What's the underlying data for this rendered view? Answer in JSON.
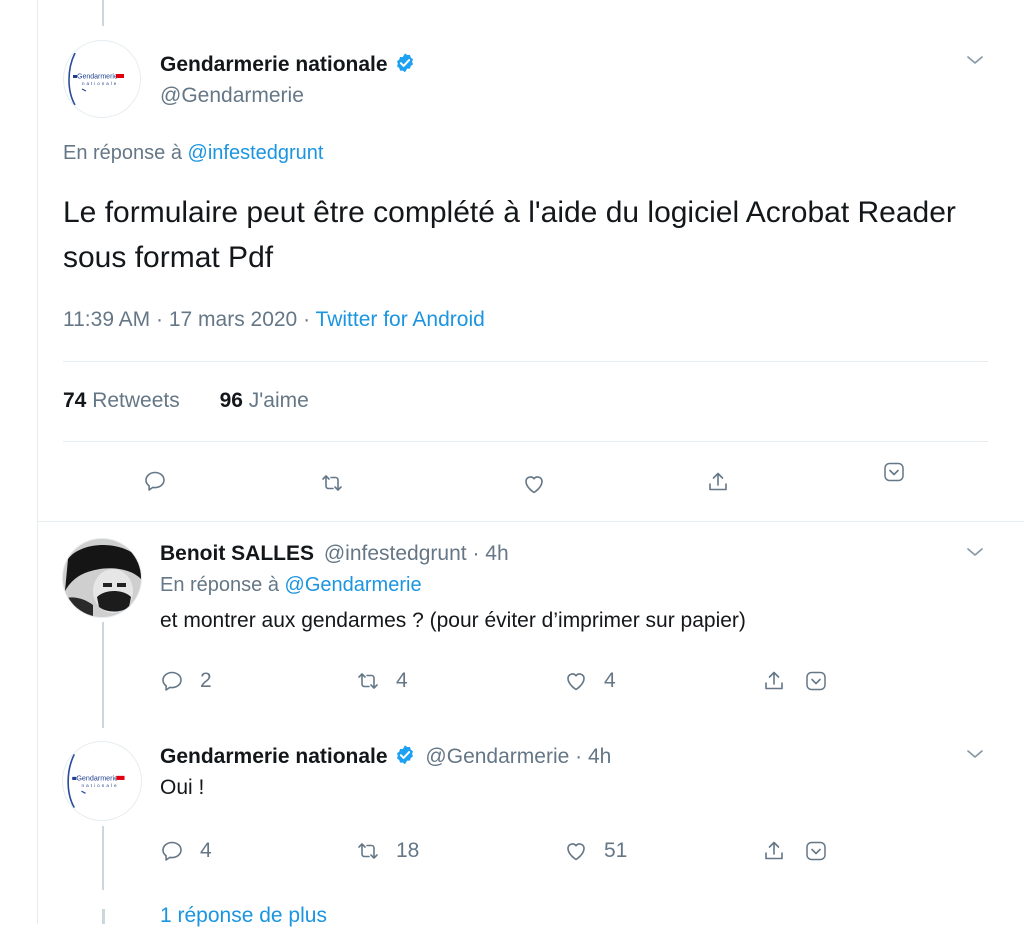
{
  "main_tweet": {
    "author_name": "Gendarmerie nationale",
    "author_handle": "@Gendarmerie",
    "avatar_text": "Gendarmerie",
    "avatar_subtext": "nationale",
    "reply_prefix": "En réponse à",
    "reply_to": "@infestedgrunt",
    "text": "Le formulaire peut être complété à l'aide du logiciel Acrobat Reader sous format Pdf",
    "time": "11:39 AM · 17 mars 2020 ·",
    "source": "Twitter for Android",
    "retweets_count": "74",
    "retweets_label": "Retweets",
    "likes_count": "96",
    "likes_label": "J'aime"
  },
  "replies": [
    {
      "author_name": "Benoit SALLES",
      "author_handle": "@infestedgrunt",
      "time": "· 4h",
      "reply_prefix": "En réponse à",
      "reply_to": "@Gendarmerie",
      "text": "et montrer aux gendarmes ? (pour éviter d’imprimer sur papier)",
      "reply_count": "2",
      "retweet_count": "4",
      "like_count": "4"
    },
    {
      "author_name": "Gendarmerie nationale",
      "author_handle": "@Gendarmerie",
      "time": "· 4h",
      "text": "Oui !",
      "reply_count": "4",
      "retweet_count": "18",
      "like_count": "51"
    }
  ],
  "more_replies_label": "1 réponse de plus",
  "colors": {
    "accent": "#1da1f2",
    "link": "#1b95e0",
    "secondary_text": "#657786",
    "border": "#e6ecf0"
  },
  "icons": {
    "reply": "comment-bubble-icon",
    "retweet": "retweet-icon",
    "like": "heart-icon",
    "share": "share-icon",
    "bookmark": "bookmark-chevron-icon",
    "verified": "verified-badge-icon",
    "caret": "chevron-down-icon"
  }
}
